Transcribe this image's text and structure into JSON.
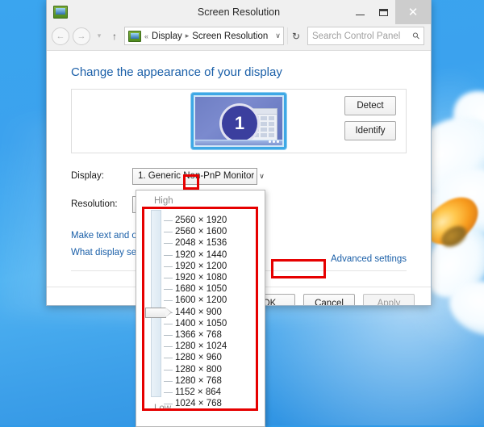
{
  "window": {
    "title": "Screen Resolution",
    "icon": "display-icon",
    "controls": {
      "minimize": "minimize-icon",
      "maximize": "maximize-icon",
      "close": "✕"
    }
  },
  "navigation": {
    "back": "←",
    "forward": "→",
    "recent_chevron": "▾",
    "up": "↑",
    "breadcrumb": {
      "overflow": "«",
      "items": [
        "Display",
        "Screen Resolution"
      ],
      "separator": "▸",
      "dropdown": "∨"
    },
    "refresh": "↻",
    "search": {
      "placeholder": "Search Control Panel",
      "icon": "search-icon"
    }
  },
  "main": {
    "heading": "Change the appearance of your display",
    "preview": {
      "monitor_number": "1",
      "detect_label": "Detect",
      "identify_label": "Identify"
    },
    "fields": {
      "display_label": "Display:",
      "display_value": "1. Generic Non-PnP Monitor",
      "resolution_label": "Resolution:",
      "resolution_value": "1440 × 900",
      "dropdown_arrow": "∨"
    },
    "links": {
      "make_text": "Make text and other items larger or smaller",
      "what_display": "What display settings should I choose?",
      "advanced": "Advanced settings"
    },
    "buttons": {
      "ok": "OK",
      "cancel": "Cancel",
      "apply": "Apply",
      "apply_disabled": true
    }
  },
  "resolution_popup": {
    "high_label": "High",
    "low_label": "Low",
    "selected_index": 8,
    "options": [
      "2560 × 1920",
      "2560 × 1600",
      "2048 × 1536",
      "1920 × 1440",
      "1920 × 1200",
      "1920 × 1080",
      "1680 × 1050",
      "1600 × 1200",
      "1440 × 900",
      "1400 × 1050",
      "1366 × 768",
      "1280 × 1024",
      "1280 × 960",
      "1280 × 800",
      "1280 × 768",
      "1152 × 864",
      "1024 × 768"
    ]
  },
  "annotations": {
    "color": "#e60000",
    "boxes": [
      "resolution-dropdown-arrow",
      "resolution-option-list",
      "ok-button"
    ]
  }
}
